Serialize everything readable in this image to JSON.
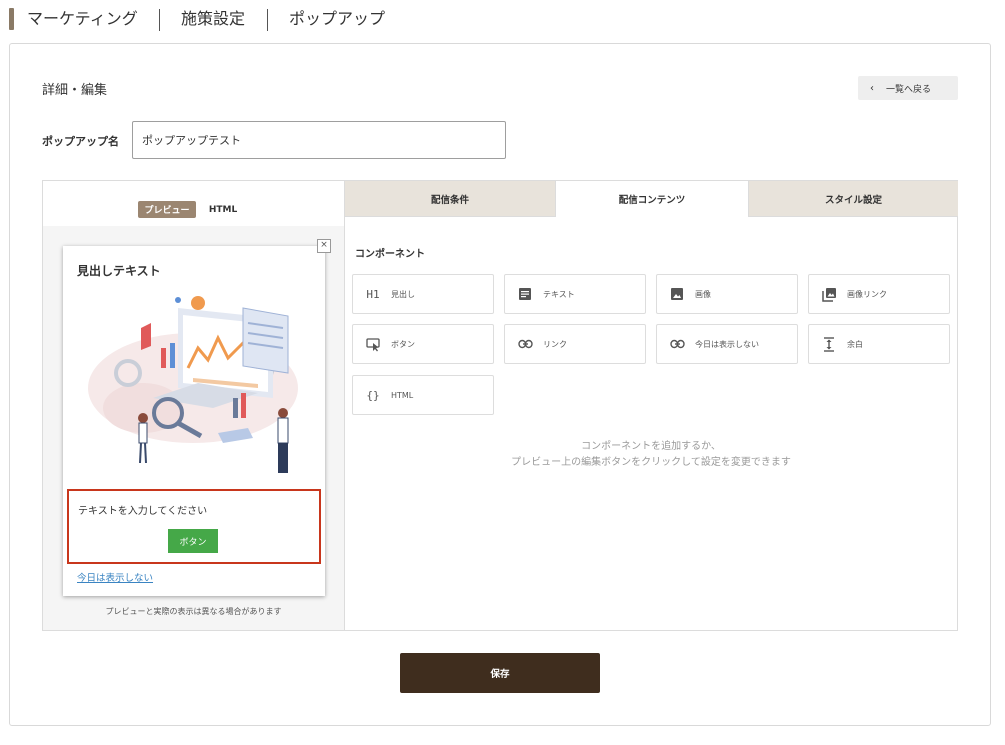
{
  "breadcrumb": {
    "items": [
      "マーケティング",
      "施策設定",
      "ポップアップ"
    ]
  },
  "page": {
    "section_title": "詳細・編集",
    "back_button": "一覧へ戻る",
    "name_label": "ポップアップ名",
    "name_value": "ポップアップテスト",
    "save_button": "保存"
  },
  "preview": {
    "toggle_preview": "プレビュー",
    "toggle_html": "HTML",
    "popup_heading": "見出しテキスト",
    "popup_text": "テキストを入力してください",
    "popup_button": "ボタン",
    "popup_link": "今日は表示しない",
    "close_glyph": "×",
    "note": "プレビューと実際の表示は異なる場合があります"
  },
  "tabs": [
    {
      "label": "配信条件",
      "active": false
    },
    {
      "label": "配信コンテンツ",
      "active": true
    },
    {
      "label": "スタイル設定",
      "active": false
    }
  ],
  "components": {
    "title": "コンポーネント",
    "items": [
      {
        "label": "見出し",
        "icon": "heading-icon"
      },
      {
        "label": "テキスト",
        "icon": "text-icon"
      },
      {
        "label": "画像",
        "icon": "image-icon"
      },
      {
        "label": "画像リンク",
        "icon": "image-link-icon"
      },
      {
        "label": "ボタン",
        "icon": "button-icon"
      },
      {
        "label": "リンク",
        "icon": "link-icon"
      },
      {
        "label": "今日は表示しない",
        "icon": "link-icon"
      },
      {
        "label": "余白",
        "icon": "spacing-icon"
      },
      {
        "label": "HTML",
        "icon": "code-icon"
      }
    ],
    "hint_line1": "コンポーネントを追加するか、",
    "hint_line2": "プレビュー上の編集ボタンをクリックして設定を変更できます"
  },
  "colors": {
    "accent_brown": "#9b8671",
    "dark_brown": "#3f2d1e",
    "tab_bg": "#e8e3db",
    "green_button": "#45a848",
    "selection_red": "#c8361c",
    "link_blue": "#3a84c2"
  }
}
